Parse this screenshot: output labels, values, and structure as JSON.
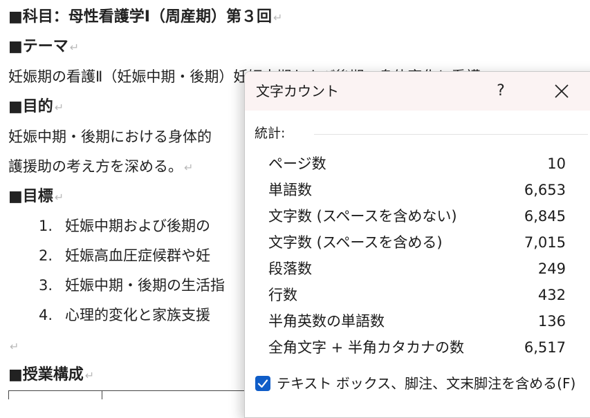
{
  "document": {
    "title": "■科目：母性看護学Ⅰ（周産期）第３回",
    "theme_heading": "■テーマ",
    "theme_text": "妊娠期の看護Ⅱ（妊娠中期・後期）妊娠中期および後期の身体変化と看護",
    "purpose_heading": "■目的",
    "purpose_line1": "妊娠中期・後期における身体的",
    "purpose_line2": "護援助の考え方を深める。",
    "goals_heading": "■目標",
    "goals": [
      {
        "num": "1.",
        "text": "妊娠中期および後期の"
      },
      {
        "num": "2.",
        "text": "妊娠高血圧症候群や妊"
      },
      {
        "num": "3.",
        "text": "妊娠中期・後期の生活指"
      },
      {
        "num": "4.",
        "text": "心理的変化と家族支援"
      }
    ],
    "class_heading": "■授業構成",
    "return_mark": "↵"
  },
  "dialog": {
    "title": "文字カウント",
    "help_label": "?",
    "section_label": "統計:",
    "stats": [
      {
        "label": "ページ数",
        "value": "10"
      },
      {
        "label": "単語数",
        "value": "6,653"
      },
      {
        "label": "文字数 (スペースを含めない)",
        "value": "6,845"
      },
      {
        "label": "文字数 (スペースを含める)",
        "value": "7,015"
      },
      {
        "label": "段落数",
        "value": "249"
      },
      {
        "label": "行数",
        "value": "432"
      },
      {
        "label": "半角英数の単語数",
        "value": "136"
      },
      {
        "label": "全角文字 + 半角カタカナの数",
        "value": "6,517"
      }
    ],
    "checkbox_label": "テキスト ボックス、脚注、文末脚注を含める(F)",
    "checkbox_checked": true,
    "accent_color": "#0f5dc8"
  }
}
